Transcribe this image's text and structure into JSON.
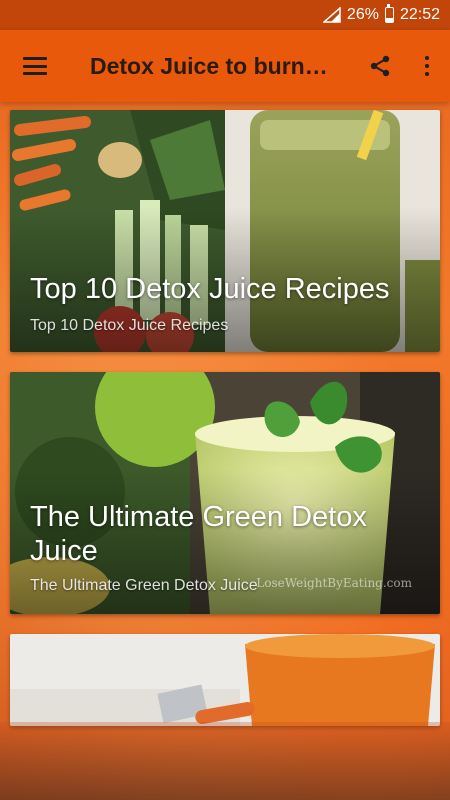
{
  "status_bar": {
    "battery_percent": "26%",
    "time": "22:52"
  },
  "app_bar": {
    "title": "Detox Juice to burn…",
    "icons": [
      "menu-icon",
      "share-icon",
      "more-vert-icon"
    ]
  },
  "cards": [
    {
      "title": "Top 10 Detox Juice Recipes",
      "subtitle": "Top 10 Detox Juice Recipes"
    },
    {
      "title": "The Ultimate Green Detox Juice",
      "subtitle": "The Ultimate Green Detox Juice",
      "watermark": "LoseWeightByEating.com"
    },
    {
      "title": "",
      "subtitle": ""
    }
  ],
  "colors": {
    "status_bar": "#c2460a",
    "app_bar": "#e8590c",
    "background": "#f07a2c"
  }
}
